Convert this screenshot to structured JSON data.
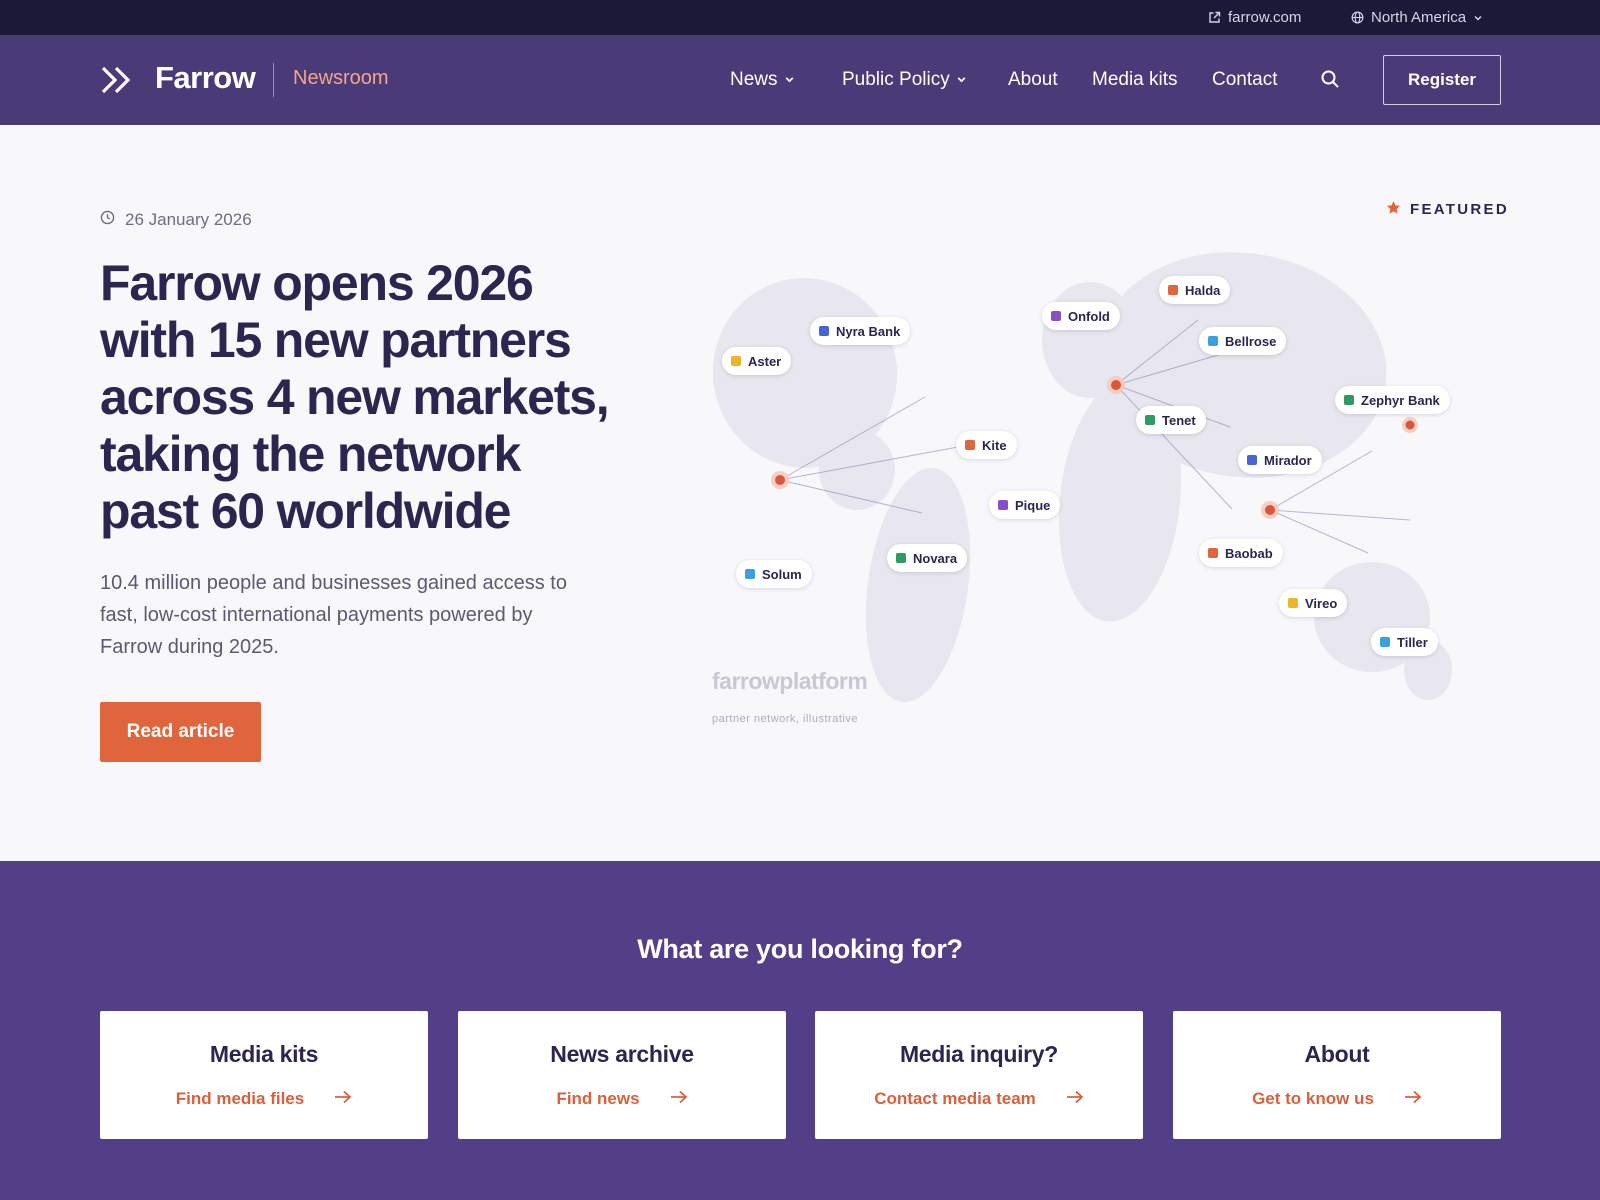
{
  "colors": {
    "utility_bar": "#1c1938",
    "header": "#4b3a78",
    "lower_section": "#533f87",
    "accent": "#e0643c",
    "heading": "#2a2650"
  },
  "utility": {
    "site_link": "farrow.com",
    "region": "North America"
  },
  "header": {
    "logo_text": "Farrow",
    "section_name": "Newsroom",
    "nav": {
      "news": "News",
      "public_policy": "Public Policy",
      "about": "About",
      "media_kits": "Media kits",
      "contact": "Contact"
    },
    "register_label": "Register"
  },
  "hero": {
    "date": "26 January 2026",
    "featured_label": "FEATURED",
    "headline": "Farrow opens 2026 with 15 new partners across 4 new markets, taking the network past 60 worldwide",
    "lede": "10.4 million people and businesses gained access to fast, low-cost international payments powered by Farrow during 2025.",
    "cta_label": "Read article"
  },
  "map": {
    "brand": "farrowplatform",
    "caption": "partner network, illustrative",
    "partners": [
      {
        "name": "Aster",
        "color": "#f0b429"
      },
      {
        "name": "Nyra Bank",
        "color": "#4a63d4"
      },
      {
        "name": "Onfold",
        "color": "#8a4fc7"
      },
      {
        "name": "Halda",
        "color": "#e0643c"
      },
      {
        "name": "Bellrose",
        "color": "#3aa0e0"
      },
      {
        "name": "Zephyr Bank",
        "color": "#2e9b62"
      },
      {
        "name": "Tenet",
        "color": "#2e9b62"
      },
      {
        "name": "Kite",
        "color": "#e0643c"
      },
      {
        "name": "Mirador",
        "color": "#4a63d4"
      },
      {
        "name": "Pique",
        "color": "#8a4fc7"
      },
      {
        "name": "Baobab",
        "color": "#e0643c"
      },
      {
        "name": "Novara",
        "color": "#2e9b62"
      },
      {
        "name": "Solum",
        "color": "#3aa0e0"
      },
      {
        "name": "Vireo",
        "color": "#f0b429"
      },
      {
        "name": "Tiller",
        "color": "#3aa0e0"
      }
    ]
  },
  "lower": {
    "title": "What are you looking for?",
    "cards": [
      {
        "title": "Media kits",
        "link": "Find media files"
      },
      {
        "title": "News archive",
        "link": "Find news"
      },
      {
        "title": "Media inquiry?",
        "link": "Contact media team"
      },
      {
        "title": "About",
        "link": "Get to know us"
      }
    ]
  }
}
